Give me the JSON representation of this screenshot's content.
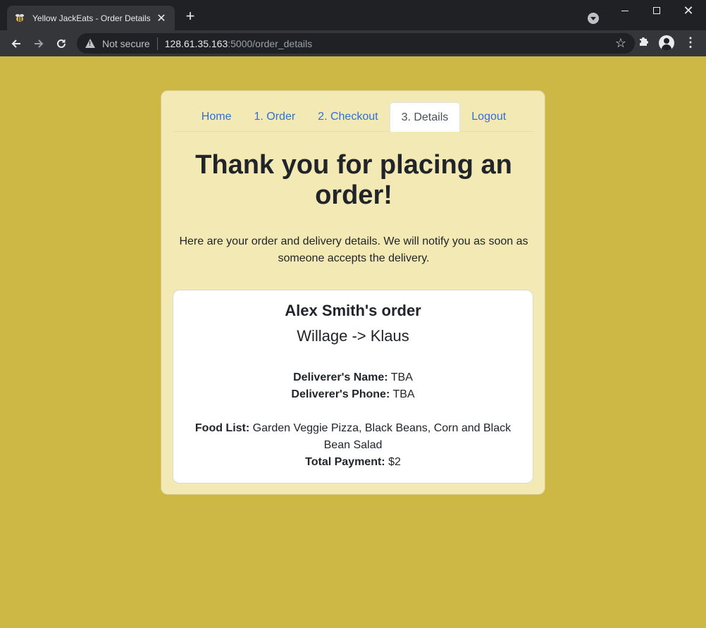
{
  "browser": {
    "tab_title": "Yellow JackEats - Order Details",
    "security_label": "Not secure",
    "url_host": "128.61.35.163",
    "url_path": ":5000/order_details"
  },
  "nav": {
    "items": [
      {
        "label": "Home"
      },
      {
        "label": "1. Order"
      },
      {
        "label": "2. Checkout"
      },
      {
        "label": "3. Details",
        "active": true
      },
      {
        "label": "Logout"
      }
    ]
  },
  "page": {
    "headline": "Thank you for placing an order!",
    "intro": "Here are your order and delivery details. We will notify you as soon as someone accepts the delivery."
  },
  "order": {
    "title": "Alex Smith's order",
    "route": "Willage -> Klaus",
    "deliverer_name_label": "Deliverer's Name:",
    "deliverer_name_value": "TBA",
    "deliverer_phone_label": "Deliverer's Phone:",
    "deliverer_phone_value": "TBA",
    "food_list_label": "Food List:",
    "food_list_value": "Garden Veggie Pizza, Black Beans, Corn and Black Bean Salad",
    "total_label": "Total Payment:",
    "total_value": "$2"
  },
  "colors": {
    "page_background": "#cdb845",
    "card_background": "#f3e9b5",
    "link": "#2f6fd8"
  }
}
